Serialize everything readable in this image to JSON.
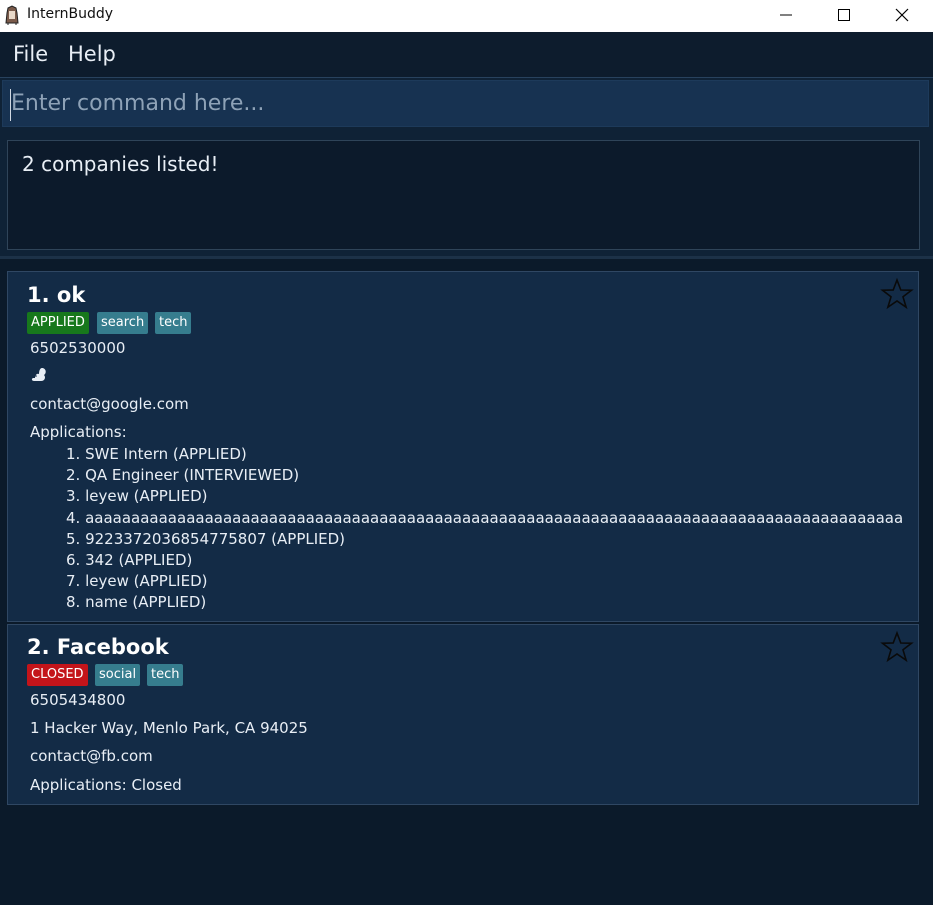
{
  "window": {
    "title": "InternBuddy"
  },
  "menu": {
    "items": [
      "File",
      "Help"
    ]
  },
  "command": {
    "placeholder": "Enter command here..."
  },
  "result": {
    "message": "2 companies listed!"
  },
  "companies": [
    {
      "title": "1. ok",
      "status": "APPLIED",
      "tags": [
        "search",
        "tech"
      ],
      "phone": "6502530000",
      "address_icon": "squirrel-icon",
      "email": "contact@google.com",
      "applications_label": "Applications:",
      "applications": [
        "1. SWE Intern (APPLIED)",
        "2. QA Engineer (INTERVIEWED)",
        "3. leyew (APPLIED)",
        "4. aaaaaaaaaaaaaaaaaaaaaaaaaaaaaaaaaaaaaaaaaaaaaaaaaaaaaaaaaaaaaaaaaaaaaaaaaaaaaaaaaaaaaaaaaaaa...",
        "5. 9223372036854775807 (APPLIED)",
        "6. 342 (APPLIED)",
        "7. leyew (APPLIED)",
        "8. name (APPLIED)"
      ],
      "starred": false
    },
    {
      "title": "2. Facebook",
      "status": "CLOSED",
      "tags": [
        "social",
        "tech"
      ],
      "phone": "6505434800",
      "address": "1 Hacker Way, Menlo Park, CA 94025",
      "email": "contact@fb.com",
      "applications_label": "Applications: Closed",
      "starred": false
    }
  ],
  "colors": {
    "background": "#0b1a2a",
    "card": "#132b46",
    "applied": "#17781c",
    "closed": "#c4141a",
    "tag": "#367d8e"
  }
}
